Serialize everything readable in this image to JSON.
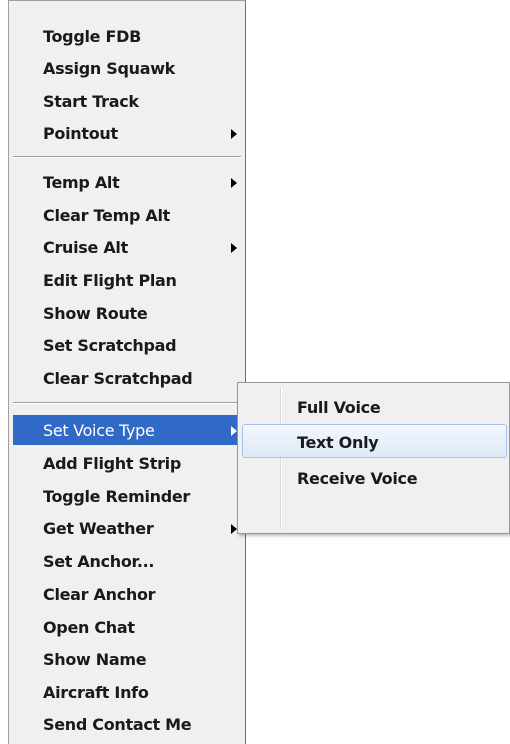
{
  "context_menu": {
    "items": [
      {
        "label": "Toggle FDB"
      },
      {
        "label": "Assign Squawk"
      },
      {
        "label": "Start Track"
      },
      {
        "label": "Pointout"
      },
      {
        "label": "Temp Alt"
      },
      {
        "label": "Clear Temp Alt"
      },
      {
        "label": "Cruise Alt"
      },
      {
        "label": "Edit Flight Plan"
      },
      {
        "label": "Show Route"
      },
      {
        "label": "Set Scratchpad"
      },
      {
        "label": "Clear Scratchpad"
      },
      {
        "label": "Set Voice Type"
      },
      {
        "label": "Add Flight Strip"
      },
      {
        "label": "Toggle Reminder"
      },
      {
        "label": "Get Weather"
      },
      {
        "label": "Set Anchor..."
      },
      {
        "label": "Clear Anchor"
      },
      {
        "label": "Open Chat"
      },
      {
        "label": "Show Name"
      },
      {
        "label": "Aircraft Info"
      },
      {
        "label": "Send Contact Me"
      }
    ],
    "highlighted_item": "Set Voice Type"
  },
  "voice_type_submenu": {
    "items": [
      {
        "label": "Full Voice"
      },
      {
        "label": "Text Only"
      },
      {
        "label": "Receive Voice"
      }
    ],
    "hovered_item": "Text Only"
  },
  "colors": {
    "menu_background": "#f0f0f0",
    "highlight": "#3169c6",
    "hover_border": "#a5c4ed"
  },
  "icons": {
    "submenu_arrow": "chevron-right-icon"
  }
}
